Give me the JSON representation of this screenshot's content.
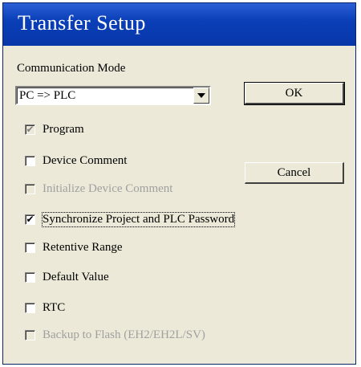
{
  "window": {
    "title": "Transfer Setup"
  },
  "mode": {
    "label": "Communication Mode",
    "selected": "PC => PLC",
    "dropdown_icon": "chevron-down-icon"
  },
  "buttons": {
    "ok": "OK",
    "cancel": "Cancel"
  },
  "options": [
    {
      "label": "Program",
      "checked": true,
      "enabled": false
    },
    {
      "label": "Device Comment",
      "checked": false,
      "enabled": true
    },
    {
      "label": "Initialize Device Comment",
      "checked": false,
      "enabled": false
    },
    {
      "label": "Synchronize Project and PLC Password",
      "checked": true,
      "enabled": true,
      "focused": true
    },
    {
      "label": "Retentive Range",
      "checked": false,
      "enabled": true
    },
    {
      "label": "Default Value",
      "checked": false,
      "enabled": true
    },
    {
      "label": "RTC",
      "checked": false,
      "enabled": true
    },
    {
      "label": "Backup to Flash (EH2/EH2L/SV)",
      "checked": false,
      "enabled": false
    }
  ],
  "colors": {
    "titlebar": "#0a3fb8",
    "face": "#ece9d8",
    "disabled_text": "#a0a0a0"
  }
}
